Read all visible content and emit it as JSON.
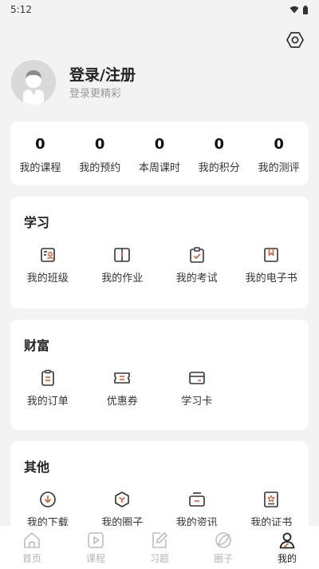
{
  "status_bar": {
    "time": "5:12"
  },
  "profile": {
    "title": "登录/注册",
    "subtitle": "登录更精彩"
  },
  "stats": [
    {
      "value": "0",
      "label": "我的课程"
    },
    {
      "value": "0",
      "label": "我的预约"
    },
    {
      "value": "0",
      "label": "本周课时"
    },
    {
      "value": "0",
      "label": "我的积分"
    },
    {
      "value": "0",
      "label": "我的测评"
    }
  ],
  "study": {
    "title": "学习",
    "items": [
      {
        "label": "我的班级",
        "icon": "class-icon"
      },
      {
        "label": "我的作业",
        "icon": "homework-book-icon"
      },
      {
        "label": "我的考试",
        "icon": "exam-clipboard-icon"
      },
      {
        "label": "我的电子书",
        "icon": "ebook-bookmark-icon"
      }
    ]
  },
  "wealth": {
    "title": "财富",
    "items": [
      {
        "label": "我的订单",
        "icon": "order-icon"
      },
      {
        "label": "优惠券",
        "icon": "coupon-icon"
      },
      {
        "label": "学习卡",
        "icon": "card-icon"
      }
    ]
  },
  "other": {
    "title": "其他",
    "items": [
      {
        "label": "我的下载",
        "icon": "download-icon"
      },
      {
        "label": "我的圈子",
        "icon": "circle-icon"
      },
      {
        "label": "我的资讯",
        "icon": "news-icon"
      },
      {
        "label": "我的证书",
        "icon": "certificate-icon"
      }
    ]
  },
  "tabs": [
    {
      "label": "首页",
      "icon": "home-icon"
    },
    {
      "label": "课程",
      "icon": "course-play-icon"
    },
    {
      "label": "习题",
      "icon": "exercise-edit-icon"
    },
    {
      "label": "圈子",
      "icon": "circle-leaf-icon"
    },
    {
      "label": "我的",
      "icon": "profile-icon"
    }
  ],
  "colors": {
    "accent": "#e05a2b",
    "background": "#f3f3f3",
    "card": "#ffffff",
    "inactive_tab": "#b5b5b5"
  }
}
